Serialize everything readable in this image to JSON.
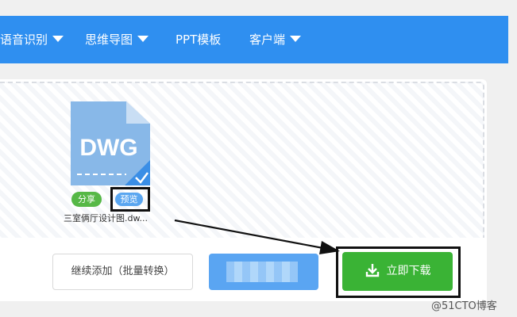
{
  "nav": {
    "items": [
      {
        "label": "语音识别",
        "has_dropdown": true
      },
      {
        "label": "思维导图",
        "has_dropdown": true
      },
      {
        "label": "PPT模板",
        "has_dropdown": false
      },
      {
        "label": "客户端",
        "has_dropdown": true
      }
    ]
  },
  "file": {
    "type_label": "DWG",
    "name": "三室俩厅设计图.dw...",
    "share_label": "分享",
    "preview_label": "预览",
    "icon": "dwg-file-icon",
    "selected_icon": "check-icon"
  },
  "actions": {
    "continue_label": "继续添加（批量转换）",
    "download_label": "立即下载",
    "download_icon": "download-icon"
  },
  "watermark": "@51CTO博客",
  "colors": {
    "nav_bg": "#2f8ff0",
    "download_green": "#3ab335",
    "share_green": "#56b846",
    "preview_blue": "#5aa6f0",
    "file_icon_blue": "#88b8e8"
  }
}
